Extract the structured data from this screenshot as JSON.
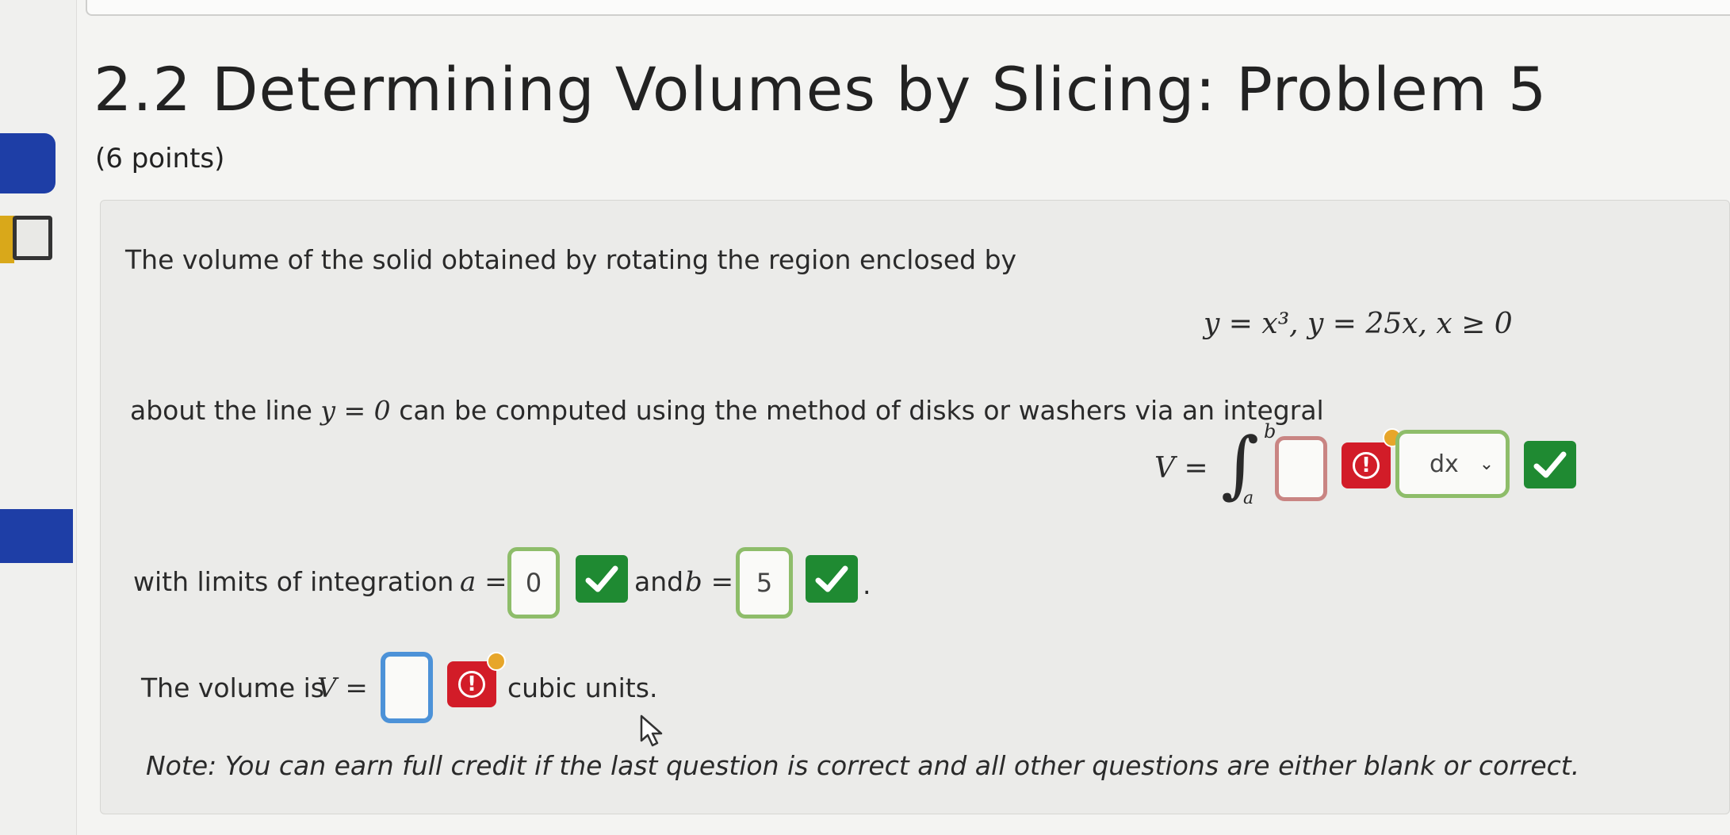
{
  "header": {
    "title": "2.2 Determining Volumes by Slicing: Problem 5",
    "points": "(6 points)"
  },
  "problem": {
    "intro": "The volume of the solid obtained by rotating the region enclosed by",
    "equation": "y = x³, y = 25x, x ≥ 0",
    "about_prefix": "about the line",
    "about_math": "y = 0",
    "about_suffix": "can be computed using the method of disks or washers via an integral",
    "integral_lhs": "V =",
    "integral_sign": "∫",
    "upper_limit": "b",
    "lower_limit": "a",
    "integrand_value": "",
    "differential_selected": "dx",
    "limits_prefix": "with limits of integration",
    "a_label": "a =",
    "a_value": "0",
    "and_text": "and",
    "b_label": "b =",
    "b_value": "5",
    "period": ".",
    "volume_prefix": "The volume is",
    "volume_label": "V =",
    "volume_value": "",
    "volume_suffix": "cubic units.",
    "note": "Note: You can earn full credit if the last question is correct and all other questions are either blank or correct."
  },
  "icons": {
    "correct": "check-icon",
    "error": "exclamation-icon",
    "chevron": "chevron-down-icon"
  },
  "colors": {
    "correct": "#1f8a32",
    "error": "#d21c28",
    "correct_border": "#8ebd6a",
    "error_border": "#c98583",
    "focus_border": "#4c92d8",
    "notification_dot": "#e7a62a",
    "nav_blue": "#1e3ea6"
  }
}
